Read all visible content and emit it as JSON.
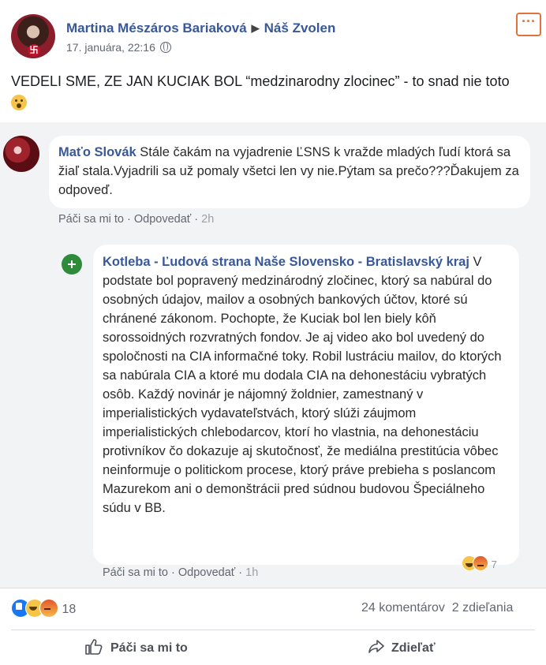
{
  "post": {
    "author": "Martina Mészáros Bariaková",
    "group": "Náš Zvolen",
    "timestamp": "17. januára, 22:16",
    "text": "VEDELI SME, ZE JAN KUCIAK BOL “medzinarodny zlocinec” - to snad nie toto"
  },
  "comments": [
    {
      "author": "Maťo Slovák",
      "text": "Stále čakám na vyjadrenie ĽSNS k vražde mladých ľudí ktorá sa žiaľ stala.Vyjadrili sa už pomaly všetci len vy nie.Pýtam sa prečo???Ďakujem za odpoveď.",
      "like_label": "Páči sa mi to",
      "reply_label": "Odpovedať",
      "time": "2h"
    },
    {
      "author": "Kotleba - Ľudová strana Naše Slovensko - Bratislavský kraj",
      "text": "V podstate bol popravený medzinárodný zločinec, ktorý sa nabúral do osobných údajov, mailov a osobných bankových účtov, ktoré sú chránené zákonom. Pochopte, že Kuciak bol len biely kôň sorossoidných rozvratných fondov. Je aj video ako bol uvedený do spoločnosti na CIA informačné toky. Robil lustráciu mailov, do ktorých sa nabúrala CIA a ktoré mu dodala CIA na dehonestáciu vybratých osôb. Každý novinár je nájomný žoldnier, zamestnaný v imperialistických vydavateľstvách, ktorý slúži záujmom imperialistických chlebodarcov, ktorí ho vlastnia, na dehonestáciu protivníkov čo dokazuje aj skutočnosť, že mediálna prestitúcia vôbec neinformuje o politickom procese, ktorý práve prebieha s poslancom Mazurekom ani o demonštrácii pred súdnou budovou Špeciálneho súdu v BB.",
      "like_label": "Páči sa mi to",
      "reply_label": "Odpovedať",
      "time": "1h",
      "reaction_count": "7"
    }
  ],
  "reactions": {
    "count": "18"
  },
  "stats": {
    "comments": "24 komentárov",
    "shares": "2 zdieľania"
  },
  "actions": {
    "like": "Páči sa mi to",
    "share": "Zdieľať"
  },
  "colors": {
    "link": "#385898",
    "more_border": "#e0733a",
    "comment_bg": "#f2f3f5"
  }
}
